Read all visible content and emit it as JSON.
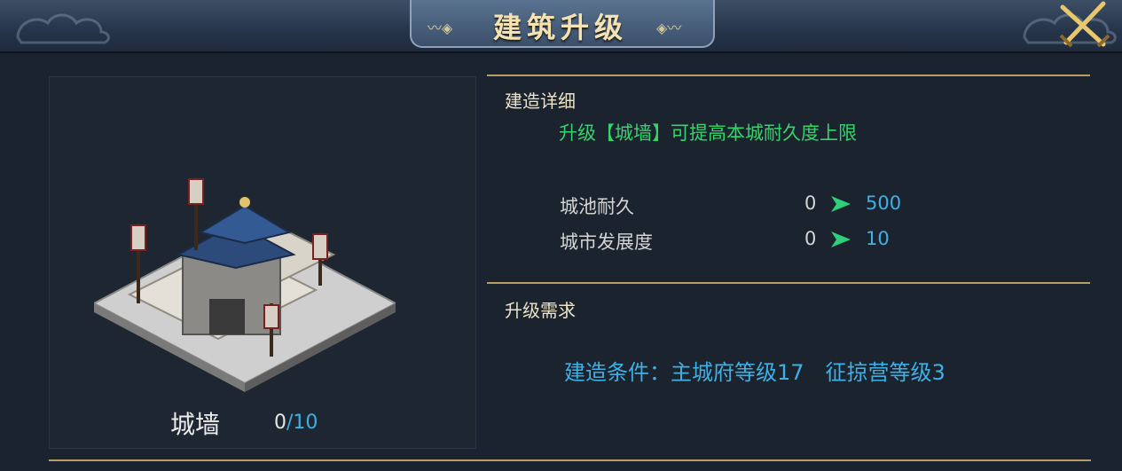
{
  "header": {
    "title": "建筑升级",
    "close_icon": "crossed-swords-close-icon"
  },
  "building": {
    "name": "城墙",
    "level_current": "0",
    "level_separator": "/",
    "level_max": "10",
    "icon": "city-wall-building-image"
  },
  "details": {
    "label": "建造详细",
    "description": "升级【城墙】可提高本城耐久度上限",
    "stats": [
      {
        "name": "城池耐久",
        "from": "0",
        "to": "500"
      },
      {
        "name": "城市发展度",
        "from": "0",
        "to": "10"
      }
    ],
    "arrow_icon": "green-arrow-icon"
  },
  "requirements": {
    "label": "升级需求",
    "condition_text": "建造条件：主城府等级17　征掠营等级3"
  },
  "colors": {
    "accent_gold": "#b79d63",
    "value_blue": "#3fb0e6",
    "desc_green": "#36d36a",
    "title_gold": "#f4e2b2"
  }
}
